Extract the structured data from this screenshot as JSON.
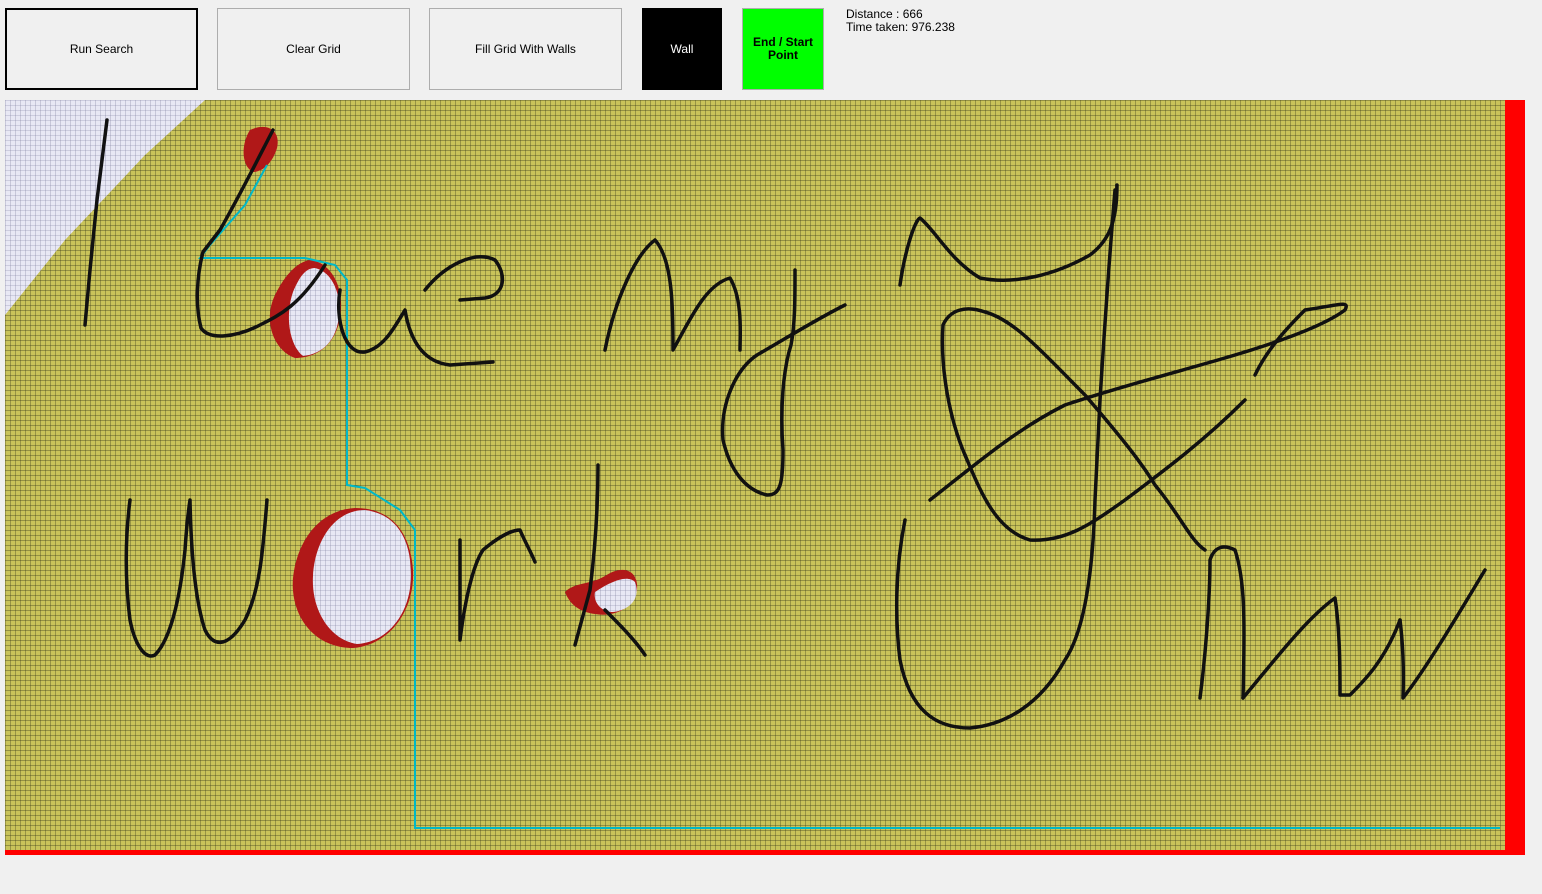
{
  "toolbar": {
    "run_label": "Run Search",
    "clear_label": "Clear Grid",
    "fill_label": "Fill Grid With Walls",
    "wall_label": "Wall",
    "endpoint_label": "End / Start Point"
  },
  "status": {
    "distance_text": "Distance : 666",
    "time_text": "Time taken: 976.238"
  },
  "colors": {
    "window_bg": "#f0f0f0",
    "grid_fill": "#c9c35a",
    "grid_line": "#3a3a1a",
    "wall": "#111111",
    "visited_red": "#b01818",
    "explored_white": "#e8e8f4",
    "path_cyan": "#00b8c8",
    "endpoint_green": "#00ff00",
    "border_red": "#ff0000"
  }
}
